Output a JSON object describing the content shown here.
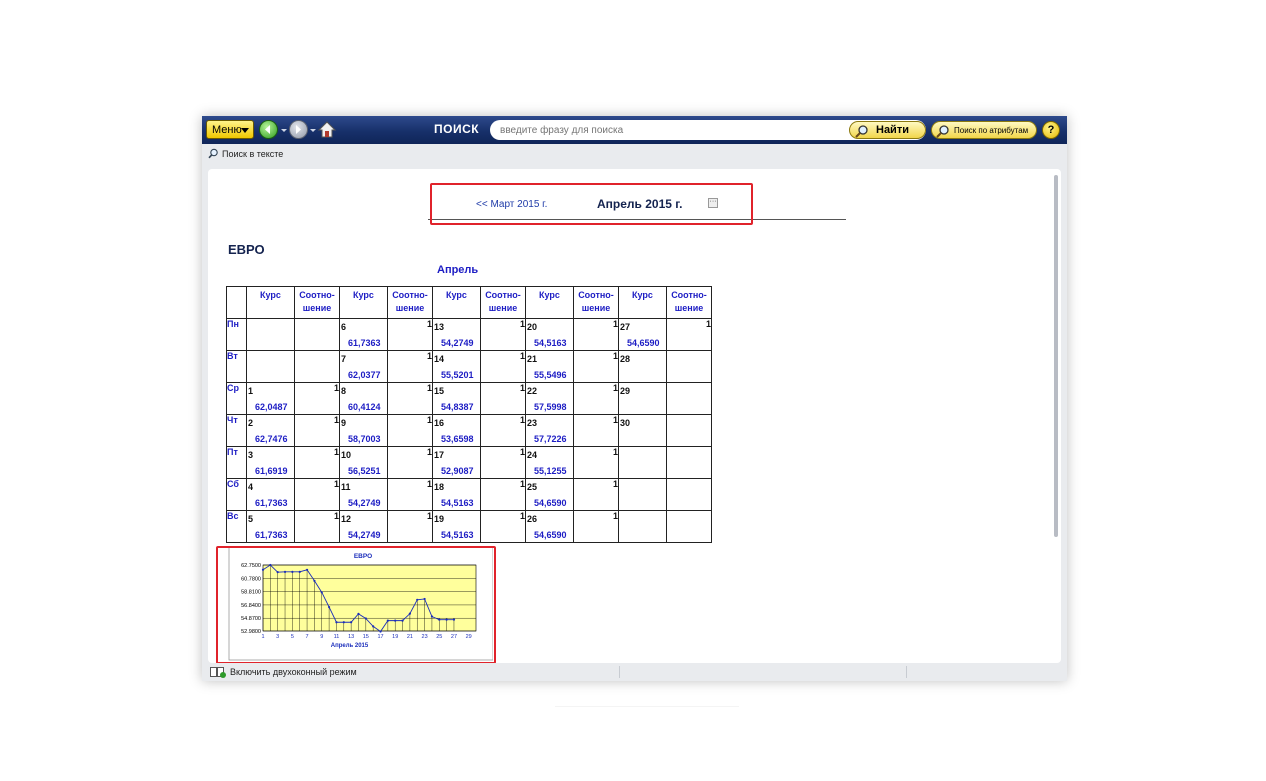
{
  "toolbar": {
    "menu_label": "Меню",
    "search_label": "ПОИСК",
    "search_placeholder": "введите фразу для поиска",
    "find_label": "Найти",
    "attr_search_label": "Поиск по атрибутам",
    "help_label": "?"
  },
  "subbar": {
    "text_search_label": "Поиск в тексте"
  },
  "month_nav": {
    "prev_label": "<< Март 2015 г.",
    "current_label": "Апрель 2015 г.",
    "more_label": "···"
  },
  "doc": {
    "title": "ЕВРО",
    "caption": "Апрель"
  },
  "table": {
    "header_rate": "Курс",
    "header_ratio_1": "Соотно-",
    "header_ratio_2": "шение",
    "rows": [
      {
        "day": "Пн",
        "cells": [
          {
            "d": "",
            "v": "",
            "r": ""
          },
          {
            "d": "6",
            "v": "61,7363",
            "r": "1"
          },
          {
            "d": "13",
            "v": "54,2749",
            "r": "1"
          },
          {
            "d": "20",
            "v": "54,5163",
            "r": "1"
          },
          {
            "d": "27",
            "v": "54,6590",
            "r": "1"
          }
        ]
      },
      {
        "day": "Вт",
        "cells": [
          {
            "d": "",
            "v": "",
            "r": ""
          },
          {
            "d": "7",
            "v": "62,0377",
            "r": "1"
          },
          {
            "d": "14",
            "v": "55,5201",
            "r": "1"
          },
          {
            "d": "21",
            "v": "55,5496",
            "r": "1"
          },
          {
            "d": "28",
            "v": "",
            "r": ""
          }
        ]
      },
      {
        "day": "Ср",
        "cells": [
          {
            "d": "1",
            "v": "62,0487",
            "r": "1"
          },
          {
            "d": "8",
            "v": "60,4124",
            "r": "1"
          },
          {
            "d": "15",
            "v": "54,8387",
            "r": "1"
          },
          {
            "d": "22",
            "v": "57,5998",
            "r": "1"
          },
          {
            "d": "29",
            "v": "",
            "r": ""
          }
        ]
      },
      {
        "day": "Чт",
        "cells": [
          {
            "d": "2",
            "v": "62,7476",
            "r": "1"
          },
          {
            "d": "9",
            "v": "58,7003",
            "r": "1"
          },
          {
            "d": "16",
            "v": "53,6598",
            "r": "1"
          },
          {
            "d": "23",
            "v": "57,7226",
            "r": "1"
          },
          {
            "d": "30",
            "v": "",
            "r": ""
          }
        ]
      },
      {
        "day": "Пт",
        "cells": [
          {
            "d": "3",
            "v": "61,6919",
            "r": "1"
          },
          {
            "d": "10",
            "v": "56,5251",
            "r": "1"
          },
          {
            "d": "17",
            "v": "52,9087",
            "r": "1"
          },
          {
            "d": "24",
            "v": "55,1255",
            "r": "1"
          },
          {
            "d": "",
            "v": "",
            "r": ""
          }
        ]
      },
      {
        "day": "Сб",
        "cells": [
          {
            "d": "4",
            "v": "61,7363",
            "r": "1"
          },
          {
            "d": "11",
            "v": "54,2749",
            "r": "1"
          },
          {
            "d": "18",
            "v": "54,5163",
            "r": "1"
          },
          {
            "d": "25",
            "v": "54,6590",
            "r": "1"
          },
          {
            "d": "",
            "v": "",
            "r": ""
          }
        ]
      },
      {
        "day": "Вс",
        "cells": [
          {
            "d": "5",
            "v": "61,7363",
            "r": "1"
          },
          {
            "d": "12",
            "v": "54,2749",
            "r": "1"
          },
          {
            "d": "19",
            "v": "54,5163",
            "r": "1"
          },
          {
            "d": "26",
            "v": "54,6590",
            "r": "1"
          },
          {
            "d": "",
            "v": "",
            "r": ""
          }
        ]
      }
    ]
  },
  "chart_data": {
    "type": "line",
    "title": "ЕВРО",
    "xlabel": "Апрель 2015",
    "ylabel": "",
    "x": [
      1,
      2,
      3,
      4,
      5,
      6,
      7,
      8,
      9,
      10,
      11,
      12,
      13,
      14,
      15,
      16,
      17,
      18,
      19,
      20,
      21,
      22,
      23,
      24,
      25,
      26,
      27
    ],
    "values": [
      62.0487,
      62.7476,
      61.6919,
      61.7363,
      61.7363,
      61.7363,
      62.0377,
      60.4124,
      58.7003,
      56.5251,
      54.2749,
      54.2749,
      54.2749,
      55.5201,
      54.8387,
      53.6598,
      52.9087,
      54.5163,
      54.5163,
      54.5163,
      55.5496,
      57.5998,
      57.7226,
      55.1255,
      54.659,
      54.659,
      54.659
    ],
    "x_ticks": [
      1,
      3,
      5,
      7,
      9,
      11,
      13,
      15,
      17,
      19,
      21,
      23,
      25,
      27,
      29
    ],
    "y_ticks": [
      "52.9800",
      "54.8700",
      "56.8400",
      "58.8100",
      "60.7800",
      "62.7500"
    ],
    "ylim": [
      52.98,
      62.75
    ],
    "xlim": [
      1,
      30
    ],
    "grid": true,
    "colors": {
      "plot_bg": "#ffff9c",
      "line": "#1a2dbb",
      "grid": "#000000"
    }
  },
  "status": {
    "dual_mode_label": "Включить двухоконный режим"
  },
  "colors": {
    "highlight": "#e0232b",
    "link": "#1d1dc4",
    "toolbar": "#17306a"
  }
}
